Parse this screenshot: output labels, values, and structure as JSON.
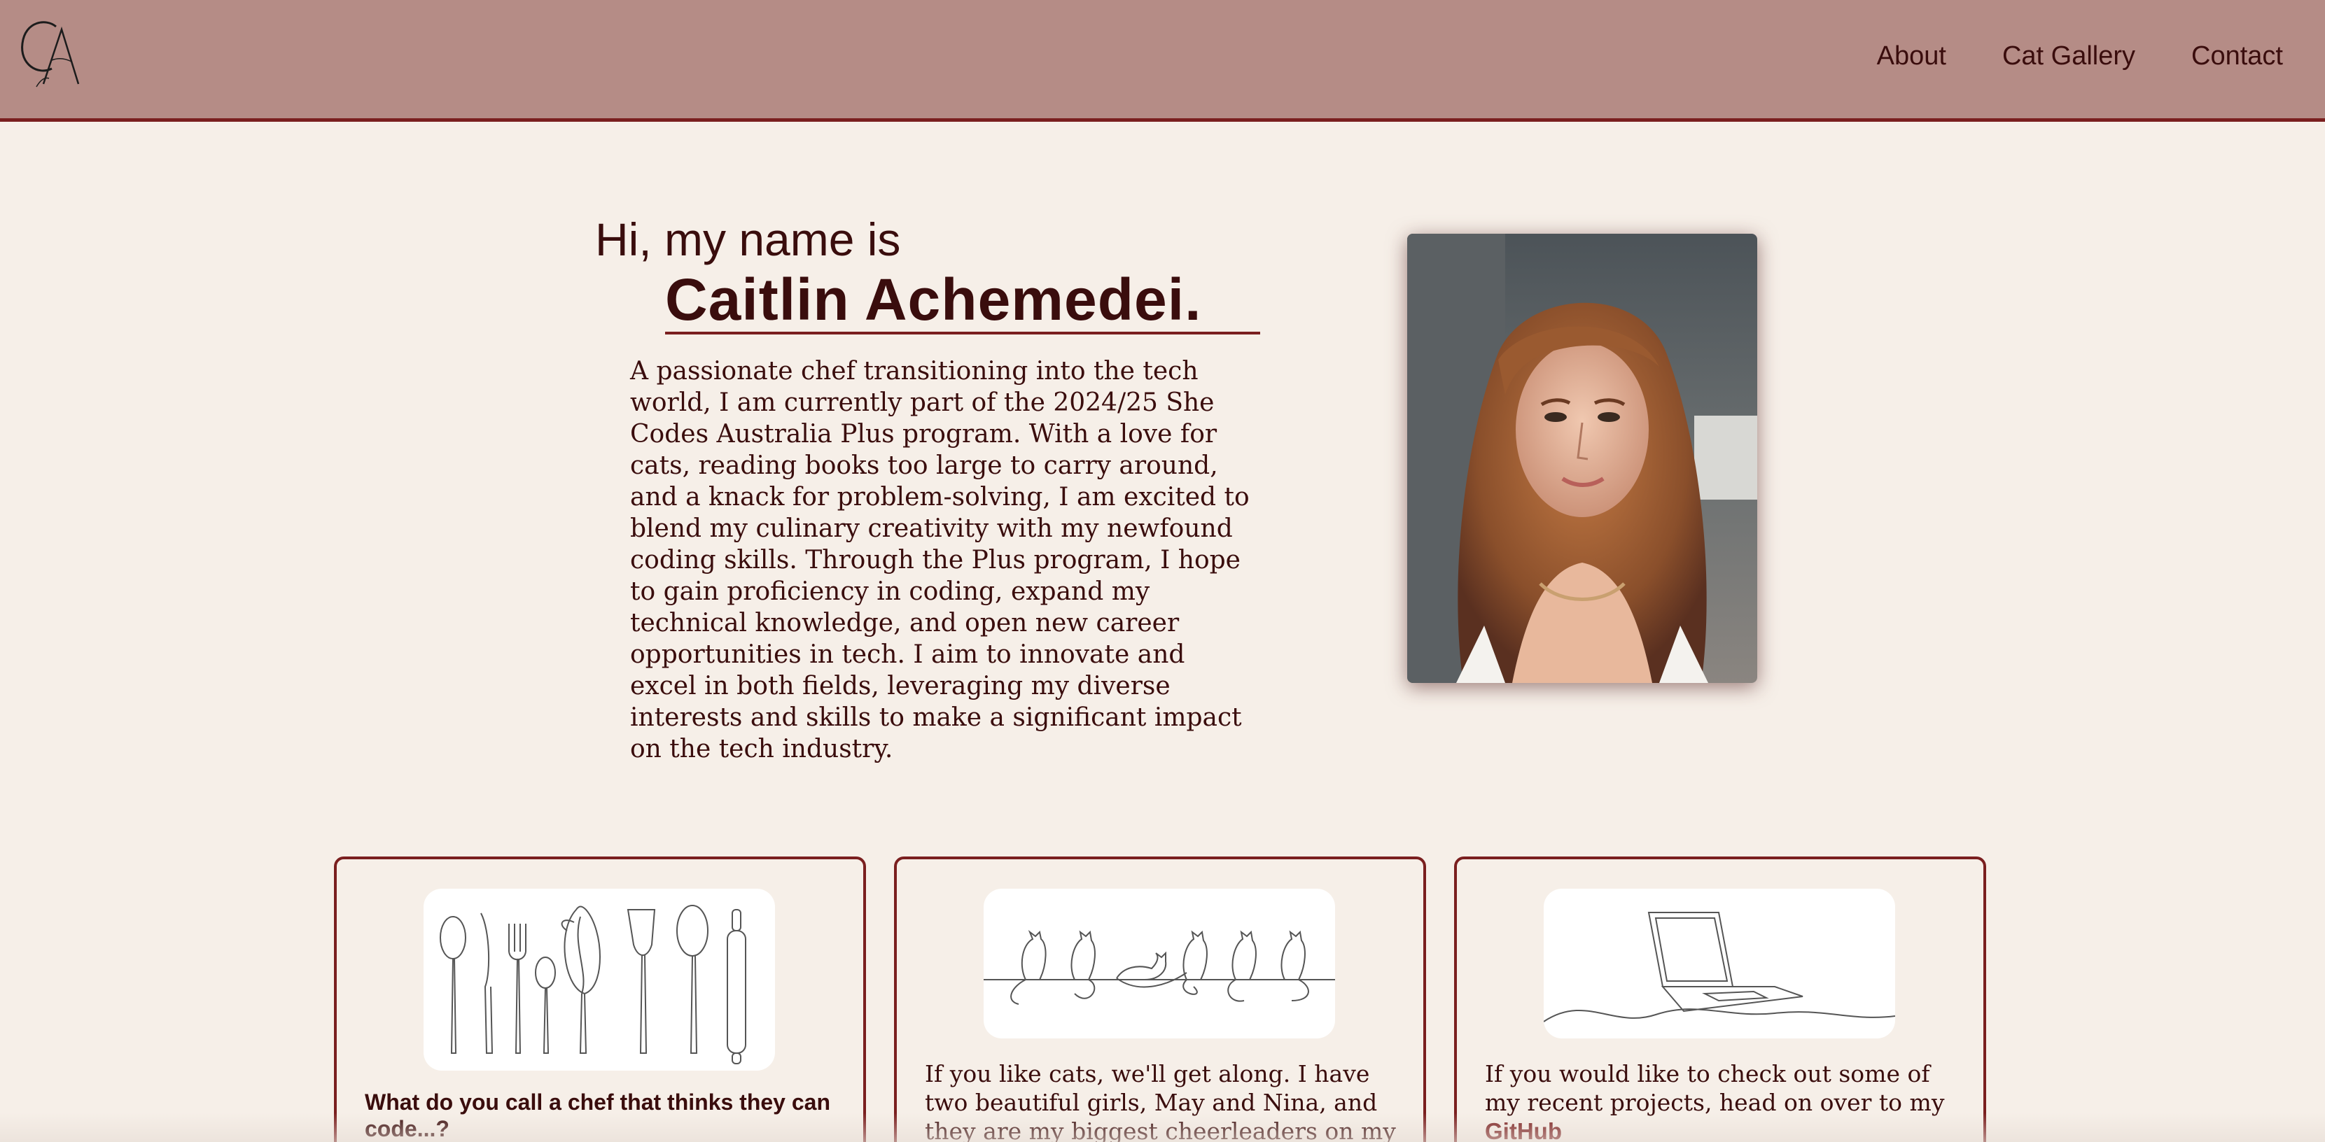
{
  "header": {
    "logo_text": "CA",
    "nav": [
      {
        "label": "About"
      },
      {
        "label": "Cat Gallery"
      },
      {
        "label": "Contact"
      }
    ],
    "background": "#b58c86",
    "accent": "#7a1f1f"
  },
  "hero": {
    "greeting": "Hi, my name is",
    "name": "Caitlin Achemedei.",
    "intro": "A passionate chef transitioning into the tech world, I am currently part of the 2024/25 She Codes Australia Plus program. With a love for cats, reading books too large to carry around, and a knack for problem-solving, I am excited to blend my culinary creativity with my newfound coding skills. Through the Plus program, I hope to gain proficiency in coding, expand my technical knowledge, and open new career opportunities in tech. I aim to innovate and excel in both fields, leveraging my diverse interests and skills to make a significant impact on the tech industry."
  },
  "cards": [
    {
      "image": "utensils-line-drawing",
      "question": "What do you call a chef that thinks they can code...?"
    },
    {
      "image": "cats-line-drawing",
      "text": "If you like cats, we'll get along. I have two beautiful girls, May and Nina, and they are my biggest cheerleaders on my coding"
    },
    {
      "image": "laptop-line-drawing",
      "text_before": "If you would like to check out some of my recent projects, head on over to my ",
      "link": "GitHub"
    }
  ],
  "colors": {
    "page_bg": "#f6efe8",
    "text": "#3a0d0d",
    "border": "#7a1f1f"
  }
}
